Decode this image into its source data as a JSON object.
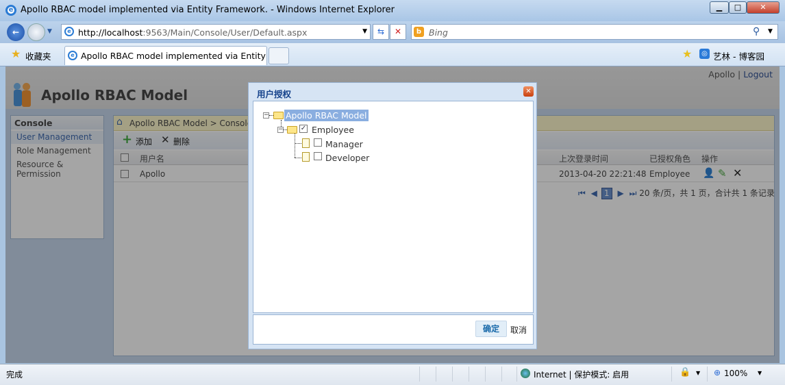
{
  "browser": {
    "window_title": "Apollo RBAC model implemented via Entity Framework. - Windows Internet Explorer",
    "url_host": "http://localhost",
    "url_rest": ":9563/Main/Console/User/Default.aspx",
    "search_placeholder": "Bing",
    "favorites_label": "收藏夹",
    "tab_title": "Apollo RBAC model implemented via Entity F...",
    "favorite_link": "艺林 - 博客园",
    "status_text": "完成",
    "zone_text": "Internet | 保护模式: 启用",
    "zoom_level": "100%"
  },
  "page": {
    "user": "Apollo",
    "separator": "|",
    "logout": "Logout",
    "app_title": "Apollo RBAC Model",
    "sidebar": {
      "heading": "Console",
      "items": [
        {
          "label": "User Management",
          "active": true
        },
        {
          "label": "Role Management"
        },
        {
          "label": "Resource & Permission"
        }
      ]
    },
    "breadcrumb": "Apollo RBAC Model > Console >",
    "toolbar": {
      "add": "添加",
      "delete": "删除"
    },
    "table": {
      "columns": [
        "用户名",
        "上次登录时间",
        "已授权角色",
        "操作"
      ],
      "rows": [
        {
          "username": "Apollo",
          "last_login": "2013-04-20 22:21:48",
          "role": "Employee"
        }
      ]
    },
    "pager": {
      "current_page": "1",
      "summary": "20 条/页，共 1 页，合计共 1 条记录"
    }
  },
  "dialog": {
    "title": "用户授权",
    "tree": {
      "root": "Apollo RBAC Model",
      "child": {
        "label": "Employee",
        "checked": true,
        "children": [
          {
            "label": "Manager",
            "checked": false
          },
          {
            "label": "Developer",
            "checked": false
          }
        ]
      }
    },
    "ok": "确定",
    "cancel": "取消"
  }
}
